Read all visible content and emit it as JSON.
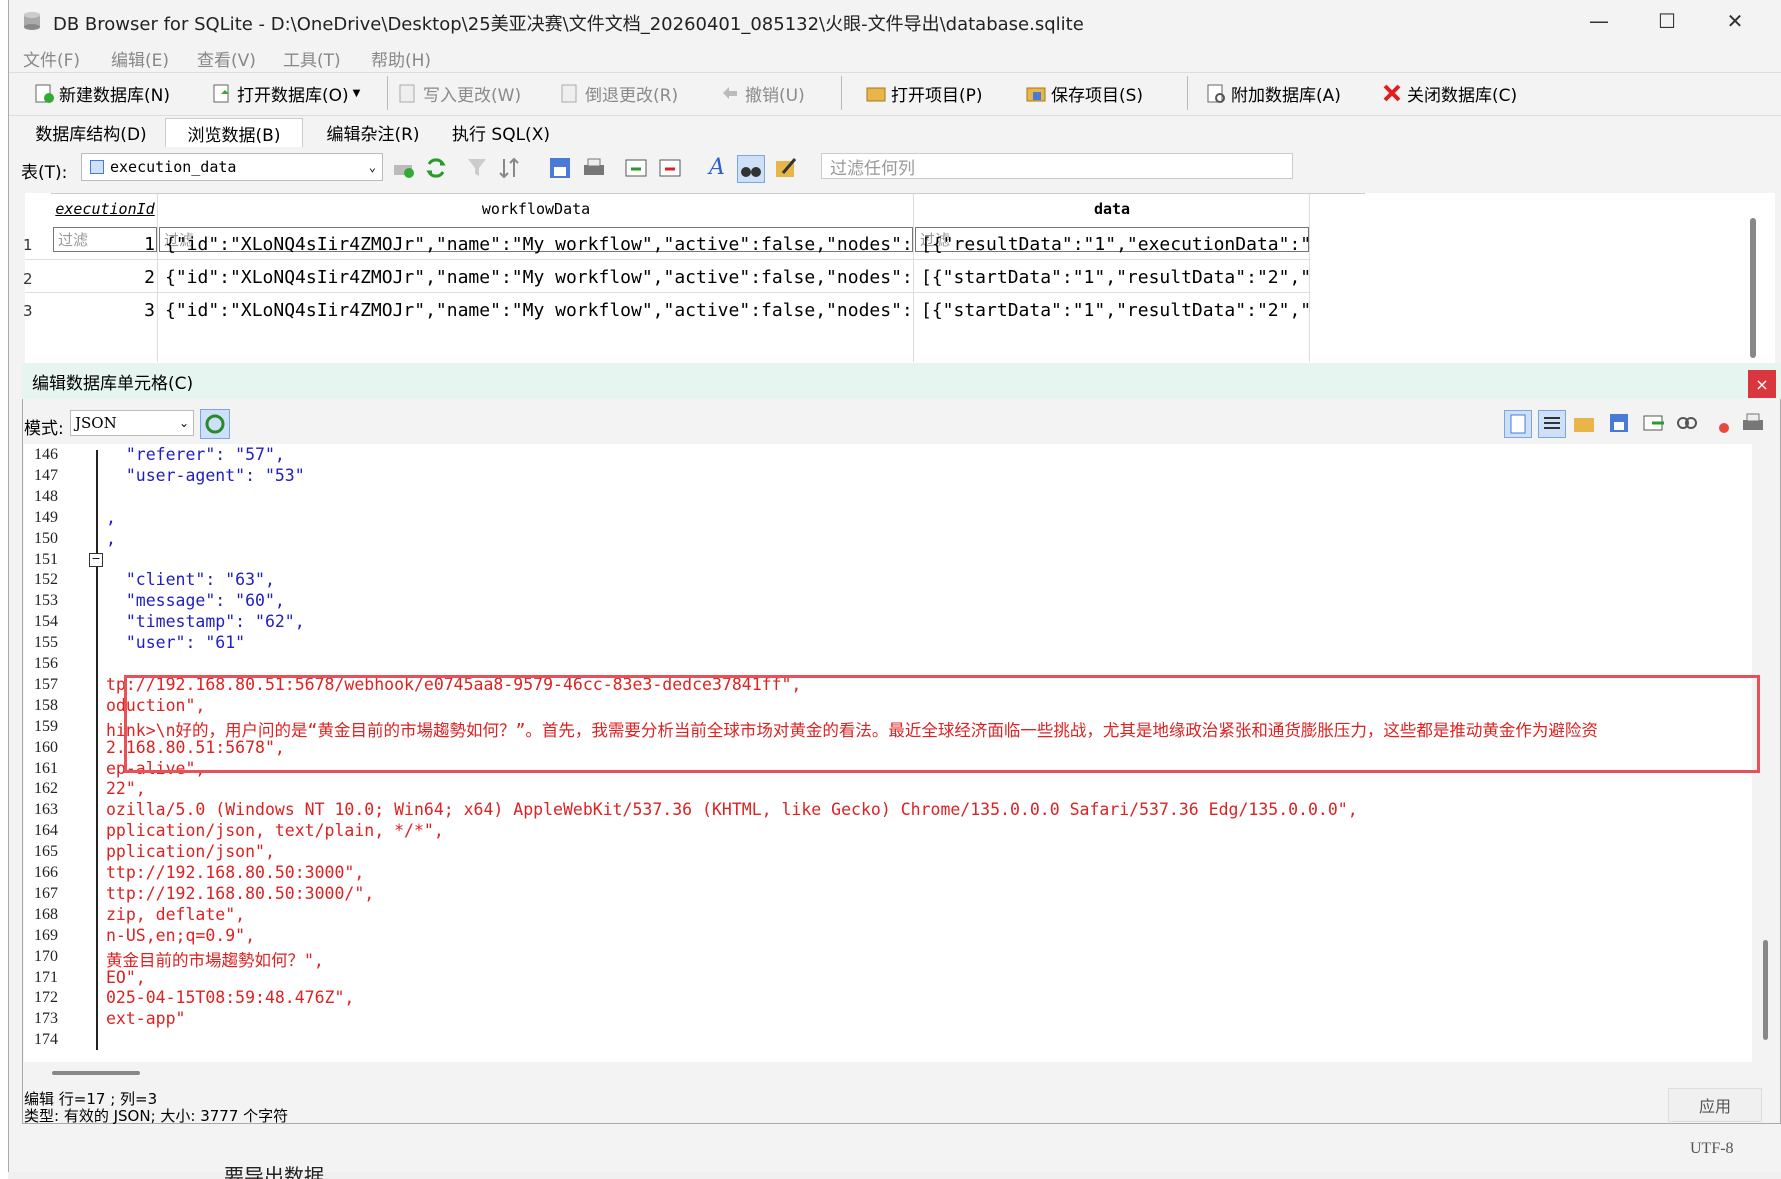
{
  "window": {
    "title": "DB Browser for SQLite - D:\\OneDrive\\Desktop\\25美亚决赛\\文件文档_20260401_085132\\火眼-文件导出\\database.sqlite",
    "minimize": "—",
    "maximize": "☐",
    "close": "✕"
  },
  "menu": [
    "文件(F)",
    "编辑(E)",
    "查看(V)",
    "工具(T)",
    "帮助(H)"
  ],
  "toolbar": {
    "new_db": "新建数据库(N)",
    "open_db": "打开数据库(O)",
    "write_changes": "写入更改(W)",
    "revert_changes": "倒退更改(R)",
    "undo": "撤销(U)",
    "open_project": "打开项目(P)",
    "save_project": "保存项目(S)",
    "attach_db": "附加数据库(A)",
    "close_db": "关闭数据库(C)"
  },
  "tabs": [
    "数据库结构(D)",
    "浏览数据(B)",
    "编辑杂注(R)",
    "执行 SQL(X)"
  ],
  "browse": {
    "table_label": "表(T):",
    "table_value": "execution_data",
    "filter_any_placeholder": "过滤任何列"
  },
  "grid": {
    "columns": [
      "executionId",
      "workflowData",
      "data"
    ],
    "filter_placeholder": "过滤",
    "rows": [
      {
        "num": "1",
        "id": "1",
        "workflow": "{\"id\":\"XLoNQ4sIir4ZMOJr\",\"name\":\"My workflow\",\"active\":false,\"nodes\":…",
        "data": "[{\"resultData\":\"1\",\"executionData\":\"…"
      },
      {
        "num": "2",
        "id": "2",
        "workflow": "{\"id\":\"XLoNQ4sIir4ZMOJr\",\"name\":\"My workflow\",\"active\":false,\"nodes\":…",
        "data": "[{\"startData\":\"1\",\"resultData\":\"2\",\"…"
      },
      {
        "num": "3",
        "id": "3",
        "workflow": "{\"id\":\"XLoNQ4sIir4ZMOJr\",\"name\":\"My workflow\",\"active\":false,\"nodes\":…",
        "data": "[{\"startData\":\"1\",\"resultData\":\"2\",\"…"
      }
    ]
  },
  "editor": {
    "title": "编辑数据库单元格(C)",
    "close": "×",
    "mode_label": "模式:",
    "mode_value": "JSON",
    "lines": [
      {
        "n": "146",
        "t": "  \"referer\": \"57\","
      },
      {
        "n": "147",
        "t": "  \"user-agent\": \"53\""
      },
      {
        "n": "148",
        "t": ""
      },
      {
        "n": "149",
        "t": ","
      },
      {
        "n": "150",
        "t": ","
      },
      {
        "n": "151",
        "t": ""
      },
      {
        "n": "152",
        "t": "  \"client\": \"63\","
      },
      {
        "n": "153",
        "t": "  \"message\": \"60\","
      },
      {
        "n": "154",
        "t": "  \"timestamp\": \"62\","
      },
      {
        "n": "155",
        "t": "  \"user\": \"61\""
      },
      {
        "n": "156",
        "t": ""
      },
      {
        "n": "157",
        "t": "tp://192.168.80.51:5678/webhook/e0745aa8-9579-46cc-83e3-dedce37841ff\","
      },
      {
        "n": "158",
        "t": "oduction\","
      },
      {
        "n": "159",
        "t": "hink>\\n好的，用户问的是“黄金目前的市場趨勢如何？”。首先，我需要分析当前全球市场对黄金的看法。最近全球经济面临一些挑战，尤其是地缘政治紧张和通货膨胀压力，这些都是推动黄金作为避险资"
      },
      {
        "n": "160",
        "t": "2.168.80.51:5678\","
      },
      {
        "n": "161",
        "t": "ep-alive\","
      },
      {
        "n": "162",
        "t": "22\","
      },
      {
        "n": "163",
        "t": "ozilla/5.0 (Windows NT 10.0; Win64; x64) AppleWebKit/537.36 (KHTML, like Gecko) Chrome/135.0.0.0 Safari/537.36 Edg/135.0.0.0\","
      },
      {
        "n": "164",
        "t": "pplication/json, text/plain, */*\","
      },
      {
        "n": "165",
        "t": "pplication/json\","
      },
      {
        "n": "166",
        "t": "ttp://192.168.80.50:3000\","
      },
      {
        "n": "167",
        "t": "ttp://192.168.80.50:3000/\","
      },
      {
        "n": "168",
        "t": "zip, deflate\","
      },
      {
        "n": "169",
        "t": "n-US,en;q=0.9\","
      },
      {
        "n": "170",
        "t": "黄金目前的市場趨勢如何？\","
      },
      {
        "n": "171",
        "t": "EO\","
      },
      {
        "n": "172",
        "t": "025-04-15T08:59:48.476Z\","
      },
      {
        "n": "173",
        "t": "ext-app\""
      },
      {
        "n": "174",
        "t": ""
      }
    ],
    "status_line1": "编辑 行=17 ; 列=3",
    "status_line2": "类型: 有效的 JSON; 大小: 3777 个字符",
    "apply": "应用"
  },
  "status": {
    "encoding": "UTF-8",
    "behind_text": "要导出数据"
  },
  "colors": {
    "highlight_box": "#e8505a",
    "dock_title_bg": "#e6f5f0",
    "json_key": "#2020c0",
    "json_string": "#dd2222"
  }
}
